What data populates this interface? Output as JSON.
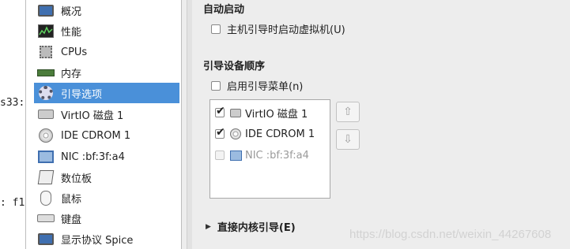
{
  "terminal": {
    "line1": "s33:",
    "line2": ":  f1"
  },
  "hardware_list": {
    "items": [
      {
        "label": "概况",
        "icon": "monitor-icon"
      },
      {
        "label": "性能",
        "icon": "performance-graph-icon"
      },
      {
        "label": "CPUs",
        "icon": "cpu-chip-icon"
      },
      {
        "label": "内存",
        "icon": "memory-module-icon"
      },
      {
        "label": "引导选项",
        "icon": "boot-options-gear-icon",
        "selected": true
      },
      {
        "label": "VirtIO 磁盘 1",
        "icon": "hard-disk-icon"
      },
      {
        "label": "IDE CDROM 1",
        "icon": "cdrom-icon"
      },
      {
        "label": "NIC :bf:3f:a4",
        "icon": "network-card-icon"
      },
      {
        "label": "数位板",
        "icon": "tablet-icon"
      },
      {
        "label": "鼠标",
        "icon": "mouse-icon"
      },
      {
        "label": "键盘",
        "icon": "keyboard-icon"
      },
      {
        "label": "显示协议 Spice",
        "icon": "display-icon"
      }
    ]
  },
  "autostart": {
    "title": "自动启动",
    "checkbox_label": "主机引导时启动虚拟机(U)",
    "checked": false
  },
  "boot_order": {
    "title": "引导设备顺序",
    "menu_checkbox_label": "启用引导菜单(n)",
    "menu_checked": false,
    "devices": [
      {
        "label": "VirtIO 磁盘 1",
        "checked": true,
        "enabled": true,
        "icon": "hard-disk-icon"
      },
      {
        "label": "IDE CDROM 1",
        "checked": true,
        "enabled": true,
        "icon": "cdrom-icon"
      },
      {
        "label": "NIC :bf:3f:a4",
        "checked": false,
        "enabled": false,
        "icon": "network-card-icon"
      }
    ],
    "move_up_icon": "arrow-up-icon",
    "move_down_icon": "arrow-down-icon"
  },
  "direct_kernel_boot": {
    "label": "直接内核引导(E)",
    "expanded": false
  },
  "watermark": "https://blog.csdn.net/weixin_44267608"
}
